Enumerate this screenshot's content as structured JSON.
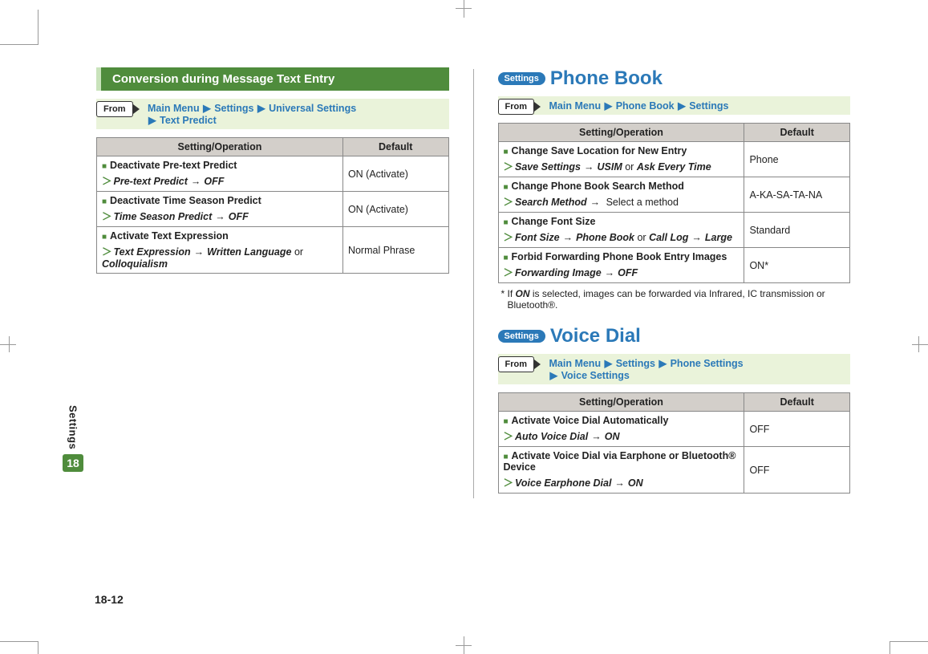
{
  "sideTab": {
    "label": "Settings",
    "num": "18"
  },
  "pageNumber": "18-12",
  "left": {
    "sectionTitle": "Conversion during Message Text Entry",
    "from": {
      "badge": "From",
      "path": [
        {
          "txt": "Main Menu"
        },
        {
          "tri": "▶"
        },
        {
          "txt": "Settings"
        },
        {
          "tri": "▶"
        },
        {
          "txt": "Universal Settings"
        },
        {
          "br": true
        },
        {
          "tri": "▶"
        },
        {
          "txt": "Text Predict"
        }
      ]
    },
    "table": {
      "headers": [
        "Setting/Operation",
        "Default"
      ],
      "rows": [
        {
          "title": "Deactivate Pre-text Predict",
          "op": [
            {
              "ital": "Pre-text Predict"
            },
            {
              "arr": "→"
            },
            {
              "ital": "OFF"
            }
          ],
          "default": "ON (Activate)"
        },
        {
          "title": "Deactivate Time Season Predict",
          "op": [
            {
              "ital": "Time Season Predict"
            },
            {
              "arr": "→"
            },
            {
              "ital": "OFF"
            }
          ],
          "default": "ON (Activate)"
        },
        {
          "title": "Activate Text Expression",
          "op": [
            {
              "ital": "Text Expression"
            },
            {
              "arr": "→"
            },
            {
              "ital": "Written Language"
            },
            {
              "plain": " or "
            },
            {
              "ital": "Colloquialism"
            }
          ],
          "default": "Normal Phrase"
        }
      ]
    }
  },
  "right": {
    "sections": [
      {
        "pill": "Settings",
        "title": "Phone Book",
        "from": {
          "badge": "From",
          "path": [
            {
              "txt": "Main Menu"
            },
            {
              "tri": "▶"
            },
            {
              "txt": "Phone Book"
            },
            {
              "tri": "▶"
            },
            {
              "txt": "Settings"
            }
          ]
        },
        "table": {
          "headers": [
            "Setting/Operation",
            "Default"
          ],
          "rows": [
            {
              "title": "Change Save Location for New Entry",
              "op": [
                {
                  "ital": "Save Settings"
                },
                {
                  "arr": "→"
                },
                {
                  "ital": "USIM"
                },
                {
                  "plain": " or "
                },
                {
                  "ital": "Ask Every Time"
                }
              ],
              "default": "Phone"
            },
            {
              "title": "Change Phone Book Search Method",
              "op": [
                {
                  "ital": "Search Method"
                },
                {
                  "arr": "→"
                },
                {
                  "plain": " Select a method"
                }
              ],
              "default": "A-KA-SA-TA-NA"
            },
            {
              "title": "Change Font Size",
              "op": [
                {
                  "ital": "Font Size"
                },
                {
                  "arr": "→"
                },
                {
                  "ital": "Phone Book"
                },
                {
                  "plain": " or "
                },
                {
                  "ital": "Call Log"
                },
                {
                  "arr": "→"
                },
                {
                  "ital": "Large"
                }
              ],
              "default": "Standard"
            },
            {
              "title": "Forbid Forwarding Phone Book Entry Images",
              "op": [
                {
                  "ital": "Forwarding Image"
                },
                {
                  "arr": "→"
                },
                {
                  "ital": "OFF"
                }
              ],
              "default": "ON*"
            }
          ]
        },
        "footnote": {
          "star": "*",
          "pre": " If ",
          "bold": "ON",
          "post": " is selected, images can be forwarded via Infrared, IC transmission or Bluetooth®."
        }
      },
      {
        "pill": "Settings",
        "title": "Voice Dial",
        "from": {
          "badge": "From",
          "path": [
            {
              "txt": "Main Menu"
            },
            {
              "tri": "▶"
            },
            {
              "txt": "Settings"
            },
            {
              "tri": "▶"
            },
            {
              "txt": "Phone Settings"
            },
            {
              "br": true
            },
            {
              "tri": "▶"
            },
            {
              "txt": "Voice Settings"
            }
          ]
        },
        "table": {
          "headers": [
            "Setting/Operation",
            "Default"
          ],
          "rows": [
            {
              "title": "Activate Voice Dial Automatically",
              "op": [
                {
                  "ital": "Auto Voice Dial"
                },
                {
                  "arr": "→"
                },
                {
                  "ital": "ON"
                }
              ],
              "default": "OFF"
            },
            {
              "title": "Activate Voice Dial via Earphone or Bluetooth® Device",
              "op": [
                {
                  "ital": "Voice Earphone Dial"
                },
                {
                  "arr": "→"
                },
                {
                  "ital": "ON"
                }
              ],
              "default": "OFF"
            }
          ]
        }
      }
    ]
  }
}
